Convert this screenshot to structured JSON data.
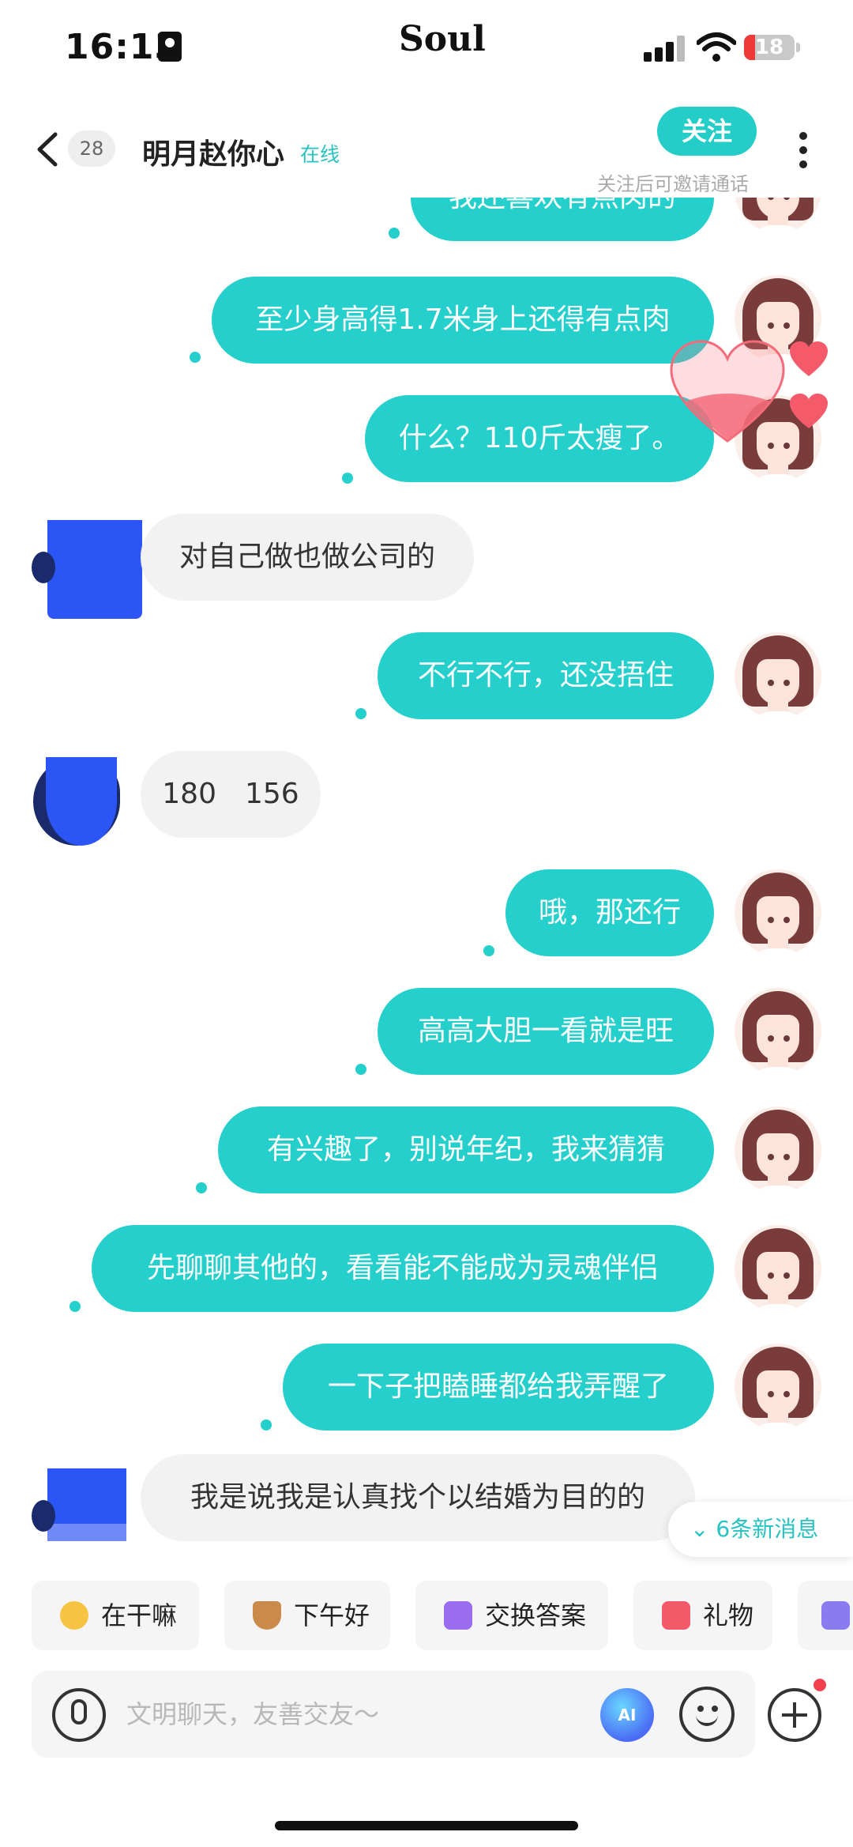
{
  "status_bar": {
    "time": "16:13",
    "app_brand": "Soul",
    "battery": "18"
  },
  "header": {
    "back_icon": "chevron-left-icon",
    "unread_count": "28",
    "contact_name": "明月赵你心",
    "online_status": "在线",
    "follow_label": "关注",
    "follow_hint": "关注后可邀请通话",
    "more_icon": "more-vertical-icon"
  },
  "messages": [
    {
      "from": "self",
      "text": "我还喜欢有点肉的"
    },
    {
      "from": "self",
      "text": "至少身高得1.7米身上还得有点肉"
    },
    {
      "from": "self",
      "text": "什么？110斤太瘦了。"
    },
    {
      "from": "other",
      "text": "对自己做也做公司的"
    },
    {
      "from": "self",
      "text": "不行不行，还没捂住"
    },
    {
      "from": "other",
      "text": "180　156"
    },
    {
      "from": "self",
      "text": "哦，那还行"
    },
    {
      "from": "self",
      "text": "高高大胆一看就是旺"
    },
    {
      "from": "self",
      "text": "有兴趣了，别说年纪，我来猜猜"
    },
    {
      "from": "self",
      "text": "先聊聊其他的，看看能不能成为灵魂伴侣"
    },
    {
      "from": "self",
      "text": "一下子把瞌睡都给我弄醒了"
    },
    {
      "from": "other",
      "text": "我是说我是认真找个以结婚为目的的"
    }
  ],
  "new_messages": "6条新消息",
  "quick_replies": [
    {
      "label": "在干嘛",
      "icon": "thinking-face-icon",
      "color": "#f6c343"
    },
    {
      "label": "下午好",
      "icon": "coffee-cup-icon",
      "color": "#c98a4a"
    },
    {
      "label": "交换答案",
      "icon": "exchange-icon",
      "color": "#9b6cf0"
    },
    {
      "label": "礼物",
      "icon": "gift-icon",
      "color": "#f25a6a"
    },
    {
      "label": "",
      "icon": "photo-icon",
      "color": "#8a7cf0"
    }
  ],
  "input": {
    "placeholder": "文明聊天，友善交友～",
    "ai_label": "AI"
  },
  "colors": {
    "accent": "#25cfcc",
    "incoming_bubble": "#f2f2f2",
    "censor_blue": "#2b55f5"
  }
}
